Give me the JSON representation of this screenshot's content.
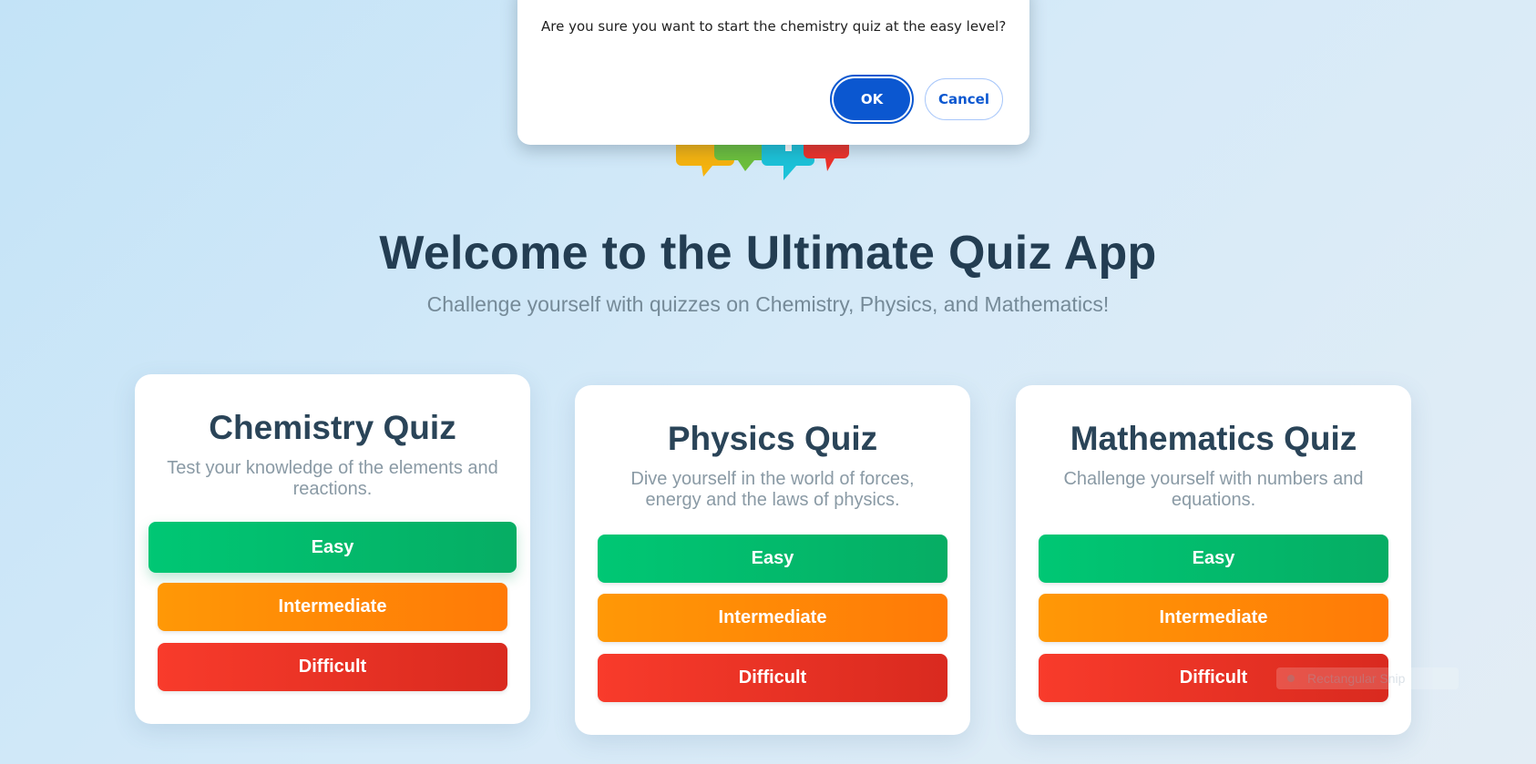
{
  "hero": {
    "title": "Welcome to the Ultimate Quiz App",
    "subtitle": "Challenge yourself with quizzes on Chemistry, Physics, and Mathematics!"
  },
  "quizzes": [
    {
      "title": "Chemistry Quiz",
      "description": "Test your knowledge of the elements and reactions.",
      "levels": [
        "Easy",
        "Intermediate",
        "Difficult"
      ]
    },
    {
      "title": "Physics Quiz",
      "description": "Dive yourself in the world of forces, energy and the laws of physics.",
      "levels": [
        "Easy",
        "Intermediate",
        "Difficult"
      ]
    },
    {
      "title": "Mathematics Quiz",
      "description": "Challenge yourself with numbers and equations.",
      "levels": [
        "Easy",
        "Intermediate",
        "Difficult"
      ]
    }
  ],
  "dialog": {
    "message": "Are you sure you want to start the chemistry quiz at the easy level?",
    "ok_label": "OK",
    "cancel_label": "Cancel"
  },
  "overlay": {
    "snip_label": "Rectangular Snip"
  },
  "colors": {
    "easy": "#00c774",
    "intermediate": "#ff8a06",
    "difficult": "#e8321f",
    "dialog_primary": "#0b57d0",
    "title_text": "#233d52"
  },
  "logo": {
    "icon": "speech-bubbles-logo-icon"
  }
}
